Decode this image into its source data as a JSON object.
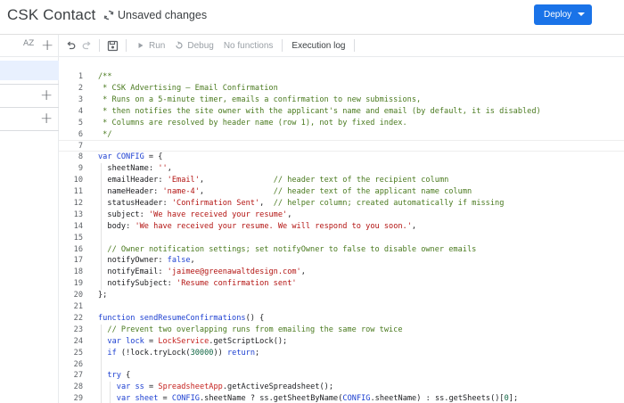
{
  "header": {
    "app_title": "CSK Contact",
    "status_text": "Unsaved changes",
    "deploy_label": "Deploy"
  },
  "left_panel": {
    "sort_icon_text": "AZ"
  },
  "toolbar": {
    "run_label": "Run",
    "debug_label": "Debug",
    "function_select": "No functions",
    "execution_log_label": "Execution log"
  },
  "editor": {
    "current_line": 7,
    "lines": [
      {
        "n": "1",
        "indent": 0,
        "tokens": [
          [
            "comment",
            "/**"
          ]
        ]
      },
      {
        "n": "2",
        "indent": 0,
        "tokens": [
          [
            "comment",
            " * CSK Advertising – Email Confirmation"
          ]
        ]
      },
      {
        "n": "3",
        "indent": 0,
        "tokens": [
          [
            "comment",
            " * Runs on a 5-minute timer, emails a confirmation to new submissions,"
          ]
        ]
      },
      {
        "n": "4",
        "indent": 0,
        "tokens": [
          [
            "comment",
            " * then notifies the site owner with the applicant's name and email (by default, it is disabled)"
          ]
        ]
      },
      {
        "n": "5",
        "indent": 0,
        "tokens": [
          [
            "comment",
            " * Columns are resolved by header name (row 1), not by fixed index."
          ]
        ]
      },
      {
        "n": "6",
        "indent": 0,
        "tokens": [
          [
            "comment",
            " */"
          ]
        ]
      },
      {
        "n": "7",
        "indent": 0,
        "tokens": []
      },
      {
        "n": "8",
        "indent": 0,
        "tokens": [
          [
            "keyword",
            "var "
          ],
          [
            "def",
            "CONFIG"
          ],
          [
            "punct",
            " = {"
          ]
        ]
      },
      {
        "n": "9",
        "indent": 1,
        "tokens": [
          [
            "prop",
            "sheetName"
          ],
          [
            "punct",
            ": "
          ],
          [
            "string",
            "''"
          ],
          [
            "punct",
            ","
          ]
        ]
      },
      {
        "n": "10",
        "indent": 1,
        "tokens": [
          [
            "prop",
            "emailHeader"
          ],
          [
            "punct",
            ": "
          ],
          [
            "string",
            "'Email'"
          ],
          [
            "punct",
            ",               "
          ],
          [
            "comment",
            "// header text of the recipient column"
          ]
        ]
      },
      {
        "n": "11",
        "indent": 1,
        "tokens": [
          [
            "prop",
            "nameHeader"
          ],
          [
            "punct",
            ": "
          ],
          [
            "string",
            "'name-4'"
          ],
          [
            "punct",
            ",               "
          ],
          [
            "comment",
            "// header text of the applicant name column"
          ]
        ]
      },
      {
        "n": "12",
        "indent": 1,
        "tokens": [
          [
            "prop",
            "statusHeader"
          ],
          [
            "punct",
            ": "
          ],
          [
            "string",
            "'Confirmation Sent'"
          ],
          [
            "punct",
            ",  "
          ],
          [
            "comment",
            "// helper column; created automatically if missing"
          ]
        ]
      },
      {
        "n": "13",
        "indent": 1,
        "tokens": [
          [
            "prop",
            "subject"
          ],
          [
            "punct",
            ": "
          ],
          [
            "string",
            "'We have received your resume'"
          ],
          [
            "punct",
            ","
          ]
        ]
      },
      {
        "n": "14",
        "indent": 1,
        "tokens": [
          [
            "prop",
            "body"
          ],
          [
            "punct",
            ": "
          ],
          [
            "string",
            "'We have received your resume. We will respond to you soon.'"
          ],
          [
            "punct",
            ","
          ]
        ]
      },
      {
        "n": "15",
        "indent": 0,
        "tokens": []
      },
      {
        "n": "16",
        "indent": 1,
        "tokens": [
          [
            "comment",
            "// Owner notification settings; set notifyOwner to false to disable owner emails"
          ]
        ]
      },
      {
        "n": "17",
        "indent": 1,
        "tokens": [
          [
            "prop",
            "notifyOwner"
          ],
          [
            "punct",
            ": "
          ],
          [
            "atom",
            "false"
          ],
          [
            "punct",
            ","
          ]
        ]
      },
      {
        "n": "18",
        "indent": 1,
        "tokens": [
          [
            "prop",
            "notifyEmail"
          ],
          [
            "punct",
            ": "
          ],
          [
            "string",
            "'jaimee@greenawaltdesign.com'"
          ],
          [
            "punct",
            ","
          ]
        ]
      },
      {
        "n": "19",
        "indent": 1,
        "tokens": [
          [
            "prop",
            "notifySubject"
          ],
          [
            "punct",
            ": "
          ],
          [
            "string",
            "'Resume confirmation sent'"
          ]
        ]
      },
      {
        "n": "20",
        "indent": 0,
        "tokens": [
          [
            "punct",
            "};"
          ]
        ]
      },
      {
        "n": "21",
        "indent": 0,
        "tokens": []
      },
      {
        "n": "22",
        "indent": 0,
        "tokens": [
          [
            "keyword",
            "function "
          ],
          [
            "def",
            "sendResumeConfirmations"
          ],
          [
            "punct",
            "() {"
          ]
        ]
      },
      {
        "n": "23",
        "indent": 1,
        "tokens": [
          [
            "comment",
            "// Prevent two overlapping runs from emailing the same row twice"
          ]
        ]
      },
      {
        "n": "24",
        "indent": 1,
        "tokens": [
          [
            "keyword",
            "var "
          ],
          [
            "def",
            "lock"
          ],
          [
            "punct",
            " = "
          ],
          [
            "var2",
            "LockService"
          ],
          [
            "punct",
            "."
          ],
          [
            "prop",
            "getScriptLock"
          ],
          [
            "punct",
            "();"
          ]
        ]
      },
      {
        "n": "25",
        "indent": 1,
        "tokens": [
          [
            "keyword",
            "if "
          ],
          [
            "punct",
            "(!"
          ],
          [
            "var",
            "lock"
          ],
          [
            "punct",
            "."
          ],
          [
            "prop",
            "tryLock"
          ],
          [
            "punct",
            "("
          ],
          [
            "number",
            "30000"
          ],
          [
            "punct",
            ")) "
          ],
          [
            "keyword",
            "return"
          ],
          [
            "punct",
            ";"
          ]
        ]
      },
      {
        "n": "26",
        "indent": 0,
        "tokens": []
      },
      {
        "n": "27",
        "indent": 1,
        "tokens": [
          [
            "keyword",
            "try "
          ],
          [
            "punct",
            "{"
          ]
        ]
      },
      {
        "n": "28",
        "indent": 2,
        "tokens": [
          [
            "keyword",
            "var "
          ],
          [
            "def",
            "ss"
          ],
          [
            "punct",
            " = "
          ],
          [
            "var2",
            "SpreadsheetApp"
          ],
          [
            "punct",
            "."
          ],
          [
            "prop",
            "getActiveSpreadsheet"
          ],
          [
            "punct",
            "();"
          ]
        ]
      },
      {
        "n": "29",
        "indent": 2,
        "tokens": [
          [
            "keyword",
            "var "
          ],
          [
            "def",
            "sheet"
          ],
          [
            "punct",
            " = "
          ],
          [
            "def",
            "CONFIG"
          ],
          [
            "punct",
            "."
          ],
          [
            "prop",
            "sheetName"
          ],
          [
            "punct",
            " ? "
          ],
          [
            "var",
            "ss"
          ],
          [
            "punct",
            "."
          ],
          [
            "prop",
            "getSheetByName"
          ],
          [
            "punct",
            "("
          ],
          [
            "def",
            "CONFIG"
          ],
          [
            "punct",
            "."
          ],
          [
            "prop",
            "sheetName"
          ],
          [
            "punct",
            ") : "
          ],
          [
            "var",
            "ss"
          ],
          [
            "punct",
            "."
          ],
          [
            "prop",
            "getSheets"
          ],
          [
            "punct",
            "()["
          ],
          [
            "number",
            "0"
          ],
          [
            "punct",
            "];"
          ]
        ]
      }
    ]
  }
}
